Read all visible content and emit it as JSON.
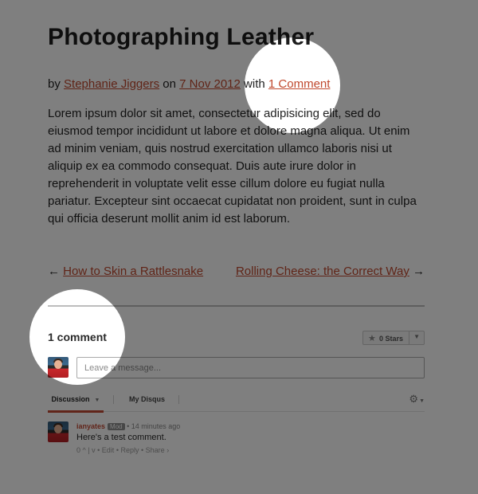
{
  "post": {
    "title": "Photographing Leather",
    "byline_by": "by",
    "author": "Stephanie Jiggers",
    "byline_on": "on",
    "date": "7 Nov 2012",
    "byline_with": "with",
    "comments_link": "1 Comment",
    "body": "Lorem ipsum dolor sit amet, consectetur adipisicing elit, sed do eiusmod tempor incididunt ut labore et dolore magna aliqua. Ut enim ad minim veniam, quis nostrud exercitation ullamco laboris nisi ut aliquip ex ea commodo consequat. Duis aute irure dolor in reprehenderit in voluptate velit esse cillum dolore eu fugiat nulla pariatur. Excepteur sint occaecat cupidatat non proident, sunt in culpa qui officia deserunt mollit anim id est laborum."
  },
  "post_nav": {
    "prev_arrow": "←",
    "prev_label": "How to Skin a Rattlesnake",
    "next_label": "Rolling Cheese: the Correct Way",
    "next_arrow": "→"
  },
  "disqus": {
    "count_label": "1 comment",
    "stars_label": "0 Stars",
    "message_placeholder": "Leave a message...",
    "tabs": [
      "Discussion",
      "My Disqus"
    ],
    "comment": {
      "username": "ianyates",
      "badge": "Mod",
      "time": "14 minutes ago",
      "text": "Here's a test comment.",
      "votes": "0",
      "edit": "Edit",
      "reply": "Reply",
      "share": "Share"
    }
  },
  "colors": {
    "link": "#c0492e",
    "overlay": "#000000"
  }
}
